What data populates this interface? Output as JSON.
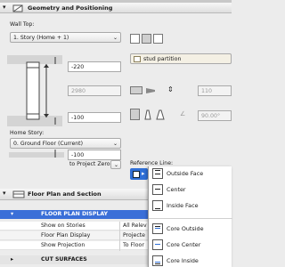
{
  "section_geometry": {
    "title": "Geometry and Positioning"
  },
  "wall_top": {
    "label": "Wall Top:",
    "value": "1. Story (Home + 1)"
  },
  "top_offset": "-220",
  "height_value": "2980",
  "bottom_offset": "-100",
  "home_story": {
    "label": "Home Story:",
    "value": "0. Ground Floor (Current)"
  },
  "home_offset": "-100",
  "project_zero": "to Project Zero",
  "stud_partition": "stud partition",
  "thickness": "110",
  "angle": "90.00°",
  "reference_line": {
    "label": "Reference Line:"
  },
  "reference_menu": [
    {
      "label": "Outside Face",
      "checked": true
    },
    {
      "label": "Center",
      "checked": false
    },
    {
      "label": "Inside Face",
      "checked": false
    },
    {
      "label": "Core Outside",
      "checked": false
    },
    {
      "label": "Core Center",
      "checked": false
    },
    {
      "label": "Core Inside",
      "checked": false
    }
  ],
  "section_floor": {
    "title": "Floor Plan and Section"
  },
  "floor_plan_display": "FLOOR PLAN DISPLAY",
  "rows": [
    {
      "name": "Show on Stories",
      "value": "All Relev"
    },
    {
      "name": "Floor Plan Display",
      "value": "Projecte"
    },
    {
      "name": "Show Projection",
      "value": "To Floor"
    }
  ],
  "cut_surfaces": "CUT SURFACES",
  "colors": {
    "accent": "#2f6fd6",
    "header_bg": "#e3e3e3",
    "blue_row": "#3a6fd8"
  }
}
